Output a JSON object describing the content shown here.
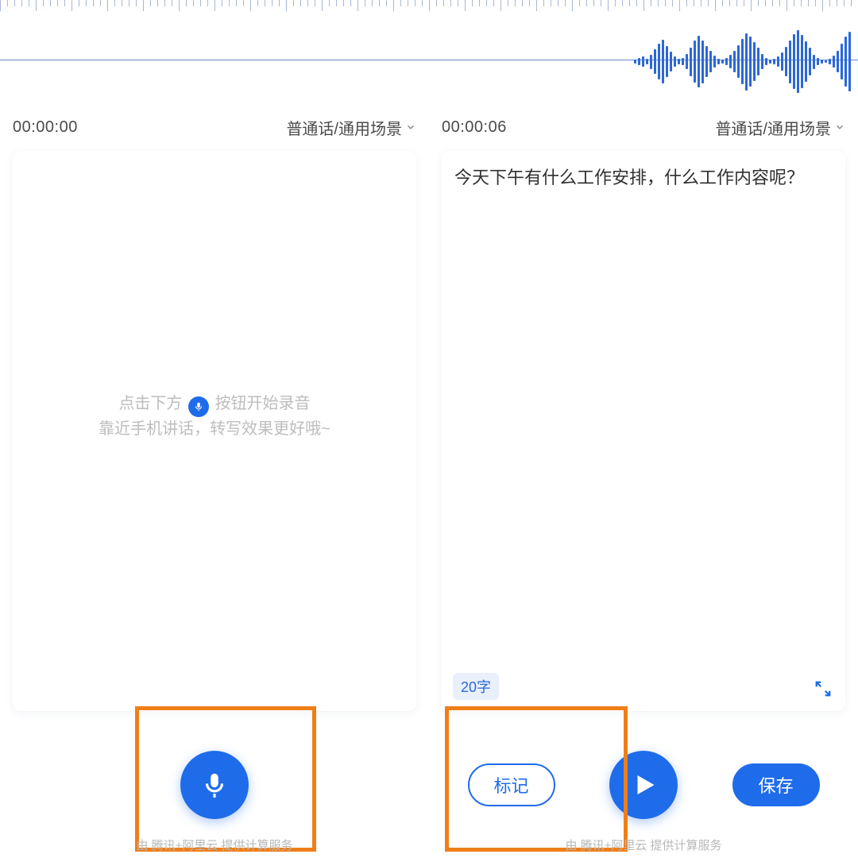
{
  "left": {
    "timer": "00:00:00",
    "language": "普通话/通用场景",
    "hint_before": "点击下方",
    "hint_after": "按钮开始录音",
    "hint_line2": "靠近手机讲话，转写效果更好哦~",
    "footer_note": "由 腾讯+阿里云 提供计算服务"
  },
  "right": {
    "timer": "00:00:06",
    "language": "普通话/通用场景",
    "transcript": "今天下午有什么工作安排，什么工作内容呢？",
    "word_count": "20字",
    "mark_label": "标记",
    "save_label": "保存",
    "footer_note": "由 腾讯+阿里云 提供计算服务"
  },
  "colors": {
    "primary": "#1f6cea",
    "highlight": "#ef7e18"
  }
}
